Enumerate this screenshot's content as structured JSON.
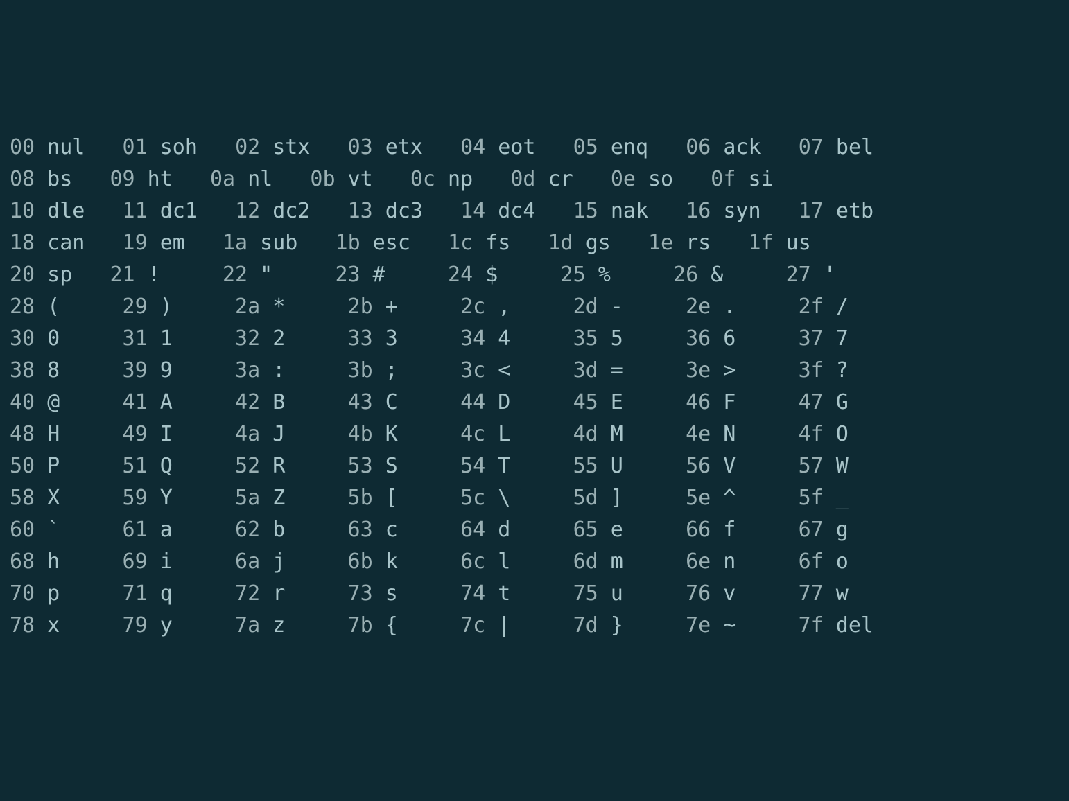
{
  "cellsPerRow": 8,
  "entries": [
    {
      "hex": "00",
      "label": "nul",
      "isName": true
    },
    {
      "hex": "01",
      "label": "soh",
      "isName": true
    },
    {
      "hex": "02",
      "label": "stx",
      "isName": true
    },
    {
      "hex": "03",
      "label": "etx",
      "isName": true
    },
    {
      "hex": "04",
      "label": "eot",
      "isName": true
    },
    {
      "hex": "05",
      "label": "enq",
      "isName": true
    },
    {
      "hex": "06",
      "label": "ack",
      "isName": true
    },
    {
      "hex": "07",
      "label": "bel",
      "isName": true
    },
    {
      "hex": "08",
      "label": "bs",
      "isName": true
    },
    {
      "hex": "09",
      "label": "ht",
      "isName": true
    },
    {
      "hex": "0a",
      "label": "nl",
      "isName": true
    },
    {
      "hex": "0b",
      "label": "vt",
      "isName": true
    },
    {
      "hex": "0c",
      "label": "np",
      "isName": true
    },
    {
      "hex": "0d",
      "label": "cr",
      "isName": true
    },
    {
      "hex": "0e",
      "label": "so",
      "isName": true
    },
    {
      "hex": "0f",
      "label": "si",
      "isName": true
    },
    {
      "hex": "10",
      "label": "dle",
      "isName": true
    },
    {
      "hex": "11",
      "label": "dc1",
      "isName": true
    },
    {
      "hex": "12",
      "label": "dc2",
      "isName": true
    },
    {
      "hex": "13",
      "label": "dc3",
      "isName": true
    },
    {
      "hex": "14",
      "label": "dc4",
      "isName": true
    },
    {
      "hex": "15",
      "label": "nak",
      "isName": true
    },
    {
      "hex": "16",
      "label": "syn",
      "isName": true
    },
    {
      "hex": "17",
      "label": "etb",
      "isName": true
    },
    {
      "hex": "18",
      "label": "can",
      "isName": true
    },
    {
      "hex": "19",
      "label": "em",
      "isName": true
    },
    {
      "hex": "1a",
      "label": "sub",
      "isName": true
    },
    {
      "hex": "1b",
      "label": "esc",
      "isName": true
    },
    {
      "hex": "1c",
      "label": "fs",
      "isName": true
    },
    {
      "hex": "1d",
      "label": "gs",
      "isName": true
    },
    {
      "hex": "1e",
      "label": "rs",
      "isName": true
    },
    {
      "hex": "1f",
      "label": "us",
      "isName": true
    },
    {
      "hex": "20",
      "label": "sp",
      "isName": true
    },
    {
      "hex": "21",
      "label": "!",
      "isName": false
    },
    {
      "hex": "22",
      "label": "\"",
      "isName": false
    },
    {
      "hex": "23",
      "label": "#",
      "isName": false
    },
    {
      "hex": "24",
      "label": "$",
      "isName": false
    },
    {
      "hex": "25",
      "label": "%",
      "isName": false
    },
    {
      "hex": "26",
      "label": "&",
      "isName": false
    },
    {
      "hex": "27",
      "label": "'",
      "isName": false
    },
    {
      "hex": "28",
      "label": "(",
      "isName": false
    },
    {
      "hex": "29",
      "label": ")",
      "isName": false
    },
    {
      "hex": "2a",
      "label": "*",
      "isName": false
    },
    {
      "hex": "2b",
      "label": "+",
      "isName": false
    },
    {
      "hex": "2c",
      "label": ",",
      "isName": false
    },
    {
      "hex": "2d",
      "label": "-",
      "isName": false
    },
    {
      "hex": "2e",
      "label": ".",
      "isName": false
    },
    {
      "hex": "2f",
      "label": "/",
      "isName": false
    },
    {
      "hex": "30",
      "label": "0",
      "isName": false
    },
    {
      "hex": "31",
      "label": "1",
      "isName": false
    },
    {
      "hex": "32",
      "label": "2",
      "isName": false
    },
    {
      "hex": "33",
      "label": "3",
      "isName": false
    },
    {
      "hex": "34",
      "label": "4",
      "isName": false
    },
    {
      "hex": "35",
      "label": "5",
      "isName": false
    },
    {
      "hex": "36",
      "label": "6",
      "isName": false
    },
    {
      "hex": "37",
      "label": "7",
      "isName": false
    },
    {
      "hex": "38",
      "label": "8",
      "isName": false
    },
    {
      "hex": "39",
      "label": "9",
      "isName": false
    },
    {
      "hex": "3a",
      "label": ":",
      "isName": false
    },
    {
      "hex": "3b",
      "label": ";",
      "isName": false
    },
    {
      "hex": "3c",
      "label": "<",
      "isName": false
    },
    {
      "hex": "3d",
      "label": "=",
      "isName": false
    },
    {
      "hex": "3e",
      "label": ">",
      "isName": false
    },
    {
      "hex": "3f",
      "label": "?",
      "isName": false
    },
    {
      "hex": "40",
      "label": "@",
      "isName": false
    },
    {
      "hex": "41",
      "label": "A",
      "isName": false
    },
    {
      "hex": "42",
      "label": "B",
      "isName": false
    },
    {
      "hex": "43",
      "label": "C",
      "isName": false
    },
    {
      "hex": "44",
      "label": "D",
      "isName": false
    },
    {
      "hex": "45",
      "label": "E",
      "isName": false
    },
    {
      "hex": "46",
      "label": "F",
      "isName": false
    },
    {
      "hex": "47",
      "label": "G",
      "isName": false
    },
    {
      "hex": "48",
      "label": "H",
      "isName": false
    },
    {
      "hex": "49",
      "label": "I",
      "isName": false
    },
    {
      "hex": "4a",
      "label": "J",
      "isName": false
    },
    {
      "hex": "4b",
      "label": "K",
      "isName": false
    },
    {
      "hex": "4c",
      "label": "L",
      "isName": false
    },
    {
      "hex": "4d",
      "label": "M",
      "isName": false
    },
    {
      "hex": "4e",
      "label": "N",
      "isName": false
    },
    {
      "hex": "4f",
      "label": "O",
      "isName": false
    },
    {
      "hex": "50",
      "label": "P",
      "isName": false
    },
    {
      "hex": "51",
      "label": "Q",
      "isName": false
    },
    {
      "hex": "52",
      "label": "R",
      "isName": false
    },
    {
      "hex": "53",
      "label": "S",
      "isName": false
    },
    {
      "hex": "54",
      "label": "T",
      "isName": false
    },
    {
      "hex": "55",
      "label": "U",
      "isName": false
    },
    {
      "hex": "56",
      "label": "V",
      "isName": false
    },
    {
      "hex": "57",
      "label": "W",
      "isName": false
    },
    {
      "hex": "58",
      "label": "X",
      "isName": false
    },
    {
      "hex": "59",
      "label": "Y",
      "isName": false
    },
    {
      "hex": "5a",
      "label": "Z",
      "isName": false
    },
    {
      "hex": "5b",
      "label": "[",
      "isName": false
    },
    {
      "hex": "5c",
      "label": "\\",
      "isName": false
    },
    {
      "hex": "5d",
      "label": "]",
      "isName": false
    },
    {
      "hex": "5e",
      "label": "^",
      "isName": false
    },
    {
      "hex": "5f",
      "label": "_",
      "isName": false
    },
    {
      "hex": "60",
      "label": "`",
      "isName": false
    },
    {
      "hex": "61",
      "label": "a",
      "isName": false
    },
    {
      "hex": "62",
      "label": "b",
      "isName": false
    },
    {
      "hex": "63",
      "label": "c",
      "isName": false
    },
    {
      "hex": "64",
      "label": "d",
      "isName": false
    },
    {
      "hex": "65",
      "label": "e",
      "isName": false
    },
    {
      "hex": "66",
      "label": "f",
      "isName": false
    },
    {
      "hex": "67",
      "label": "g",
      "isName": false
    },
    {
      "hex": "68",
      "label": "h",
      "isName": false
    },
    {
      "hex": "69",
      "label": "i",
      "isName": false
    },
    {
      "hex": "6a",
      "label": "j",
      "isName": false
    },
    {
      "hex": "6b",
      "label": "k",
      "isName": false
    },
    {
      "hex": "6c",
      "label": "l",
      "isName": false
    },
    {
      "hex": "6d",
      "label": "m",
      "isName": false
    },
    {
      "hex": "6e",
      "label": "n",
      "isName": false
    },
    {
      "hex": "6f",
      "label": "o",
      "isName": false
    },
    {
      "hex": "70",
      "label": "p",
      "isName": false
    },
    {
      "hex": "71",
      "label": "q",
      "isName": false
    },
    {
      "hex": "72",
      "label": "r",
      "isName": false
    },
    {
      "hex": "73",
      "label": "s",
      "isName": false
    },
    {
      "hex": "74",
      "label": "t",
      "isName": false
    },
    {
      "hex": "75",
      "label": "u",
      "isName": false
    },
    {
      "hex": "76",
      "label": "v",
      "isName": false
    },
    {
      "hex": "77",
      "label": "w",
      "isName": false
    },
    {
      "hex": "78",
      "label": "x",
      "isName": false
    },
    {
      "hex": "79",
      "label": "y",
      "isName": false
    },
    {
      "hex": "7a",
      "label": "z",
      "isName": false
    },
    {
      "hex": "7b",
      "label": "{",
      "isName": false
    },
    {
      "hex": "7c",
      "label": "|",
      "isName": false
    },
    {
      "hex": "7d",
      "label": "}",
      "isName": false
    },
    {
      "hex": "7e",
      "label": "~",
      "isName": false
    },
    {
      "hex": "7f",
      "label": "del",
      "isName": true
    }
  ]
}
